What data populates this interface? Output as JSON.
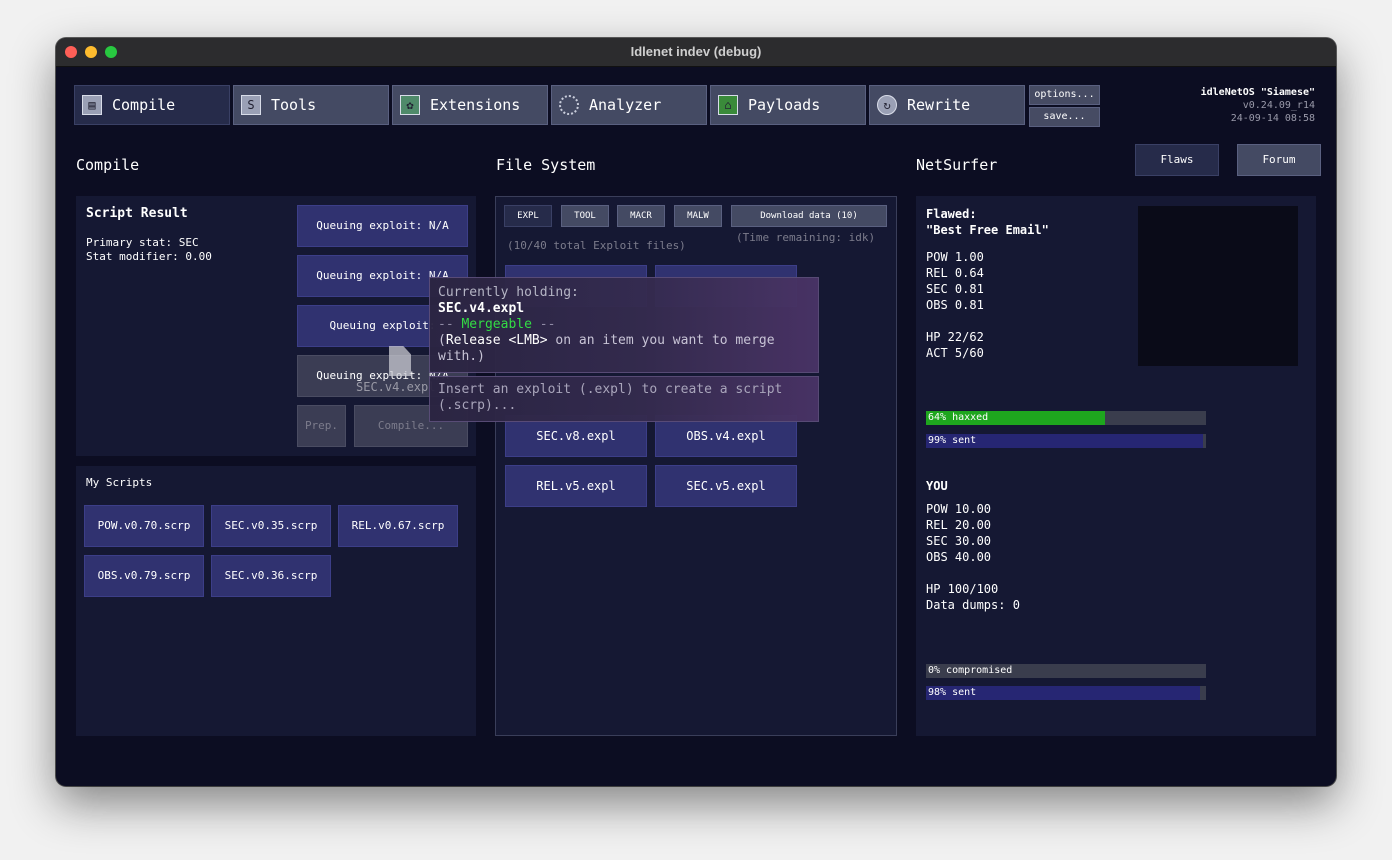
{
  "window": {
    "title": "Idlenet indev (debug)"
  },
  "tabs": [
    {
      "label": "Compile",
      "icon": "compile-icon"
    },
    {
      "label": "Tools",
      "icon": "tools-icon"
    },
    {
      "label": "Extensions",
      "icon": "extensions-icon"
    },
    {
      "label": "Analyzer",
      "icon": "analyzer-icon"
    },
    {
      "label": "Payloads",
      "icon": "payloads-icon"
    },
    {
      "label": "Rewrite",
      "icon": "rewrite-icon"
    }
  ],
  "options_label": "options...",
  "save_label": "save...",
  "os": {
    "name": "idleNetOS \"Siamese\"",
    "version": "v0.24.09_r14",
    "datetime": "24-09-14 08:58"
  },
  "compile": {
    "title": "Compile",
    "result_title": "Script Result",
    "primary_stat": "Primary stat: SEC",
    "stat_modifier": "Stat modifier: 0.00",
    "queue": [
      "Queuing exploit: N/A",
      "Queuing exploit: N/A",
      "Queuing exploit: ",
      "Queuing exploit: N/A"
    ],
    "prep_label": "Prep.",
    "compile_label": "Compile...",
    "my_scripts_title": "My Scripts",
    "scripts": [
      "POW.v0.70.scrp",
      "SEC.v0.35.scrp",
      "REL.v0.67.scrp",
      "OBS.v0.79.scrp",
      "SEC.v0.36.scrp"
    ]
  },
  "drag": {
    "label": "SEC.v4.expl"
  },
  "fs": {
    "title": "File System",
    "tabs": [
      "EXPL",
      "TOOL",
      "MACR",
      "MALW"
    ],
    "download_label": "Download data (10)",
    "total_files": "(10/40 total Exploit files)",
    "time_remaining": "(Time remaining: idk)",
    "files": [
      "SEC.v8.expl",
      "OBS.v4.expl",
      "REL.v5.expl",
      "SEC.v5.expl"
    ]
  },
  "tooltip": {
    "line1": "Currently holding:",
    "item": "SEC.v4.expl",
    "mergeable_pre": "-- ",
    "mergeable": "Mergeable",
    "mergeable_post": " --",
    "release_open": "(",
    "release_key": "Release <LMB>",
    "release_rest": " on an item you want to merge with.)",
    "hint": "Insert an exploit (.expl) to create a script (.scrp)..."
  },
  "netsurfer": {
    "title": "NetSurfer",
    "flaws_label": "Flaws",
    "forum_label": "Forum",
    "target_label": "Flawed:",
    "target_name": "\"Best Free Email\"",
    "target_stats": [
      "POW 1.00",
      "REL 0.64",
      "SEC 0.81",
      "OBS 0.81"
    ],
    "target_hp": "HP 22/62",
    "target_act": "ACT 5/60",
    "hack_bar": {
      "label": "64% haxxed",
      "value": 0.64,
      "color": "#1ea61e"
    },
    "sent_bar1": {
      "label": "99% sent",
      "value": 0.99,
      "color": "#262673"
    },
    "you_label": "YOU",
    "you_stats": [
      "POW 10.00",
      "REL 20.00",
      "SEC 30.00",
      "OBS 40.00"
    ],
    "you_hp": "HP 100/100",
    "data_dumps": "Data dumps: 0",
    "comp_bar": {
      "label": "0% compromised",
      "value": 0.0,
      "color": "#1ea61e"
    },
    "sent_bar2": {
      "label": "98% sent",
      "value": 0.98,
      "color": "#262673"
    }
  }
}
